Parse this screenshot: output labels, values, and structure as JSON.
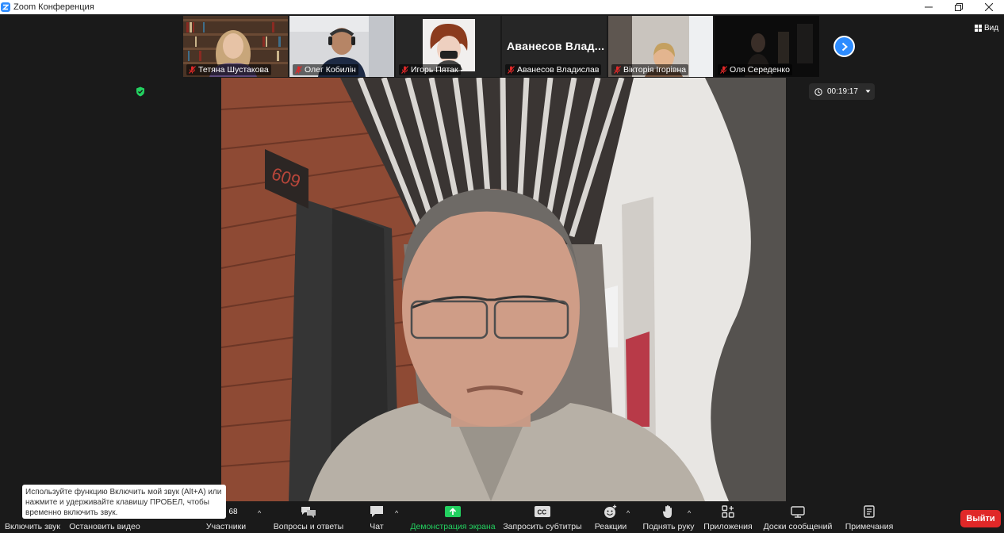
{
  "window": {
    "title": "Zoom Конференция"
  },
  "participants": [
    {
      "name": "Тетяна Шустакова"
    },
    {
      "name": "Олег Кобилін"
    },
    {
      "name": "Игорь Пятак"
    },
    {
      "name": "Аванесов Владислав",
      "display": "Аванесов  Влад..."
    },
    {
      "name": "Вікторія Ігорівна"
    },
    {
      "name": "Оля Середенко"
    }
  ],
  "view": {
    "label": "Вид"
  },
  "timer": {
    "value": "00:19:17"
  },
  "toolbar": {
    "unmute": "Включить звук",
    "stop_video": "Остановить видео",
    "participants": "Участники",
    "participants_count": "68",
    "qa": "Вопросы и ответы",
    "chat": "Чат",
    "share": "Демонстрация экрана",
    "captions": "Запросить субтитры",
    "reactions": "Реакции",
    "raise_hand": "Поднять руку",
    "apps": "Приложения",
    "whiteboards": "Доски сообщений",
    "notes": "Примечания",
    "leave": "Выйти"
  },
  "tooltip": {
    "text": "Используйте функцию Включить мой звук (Alt+A) или нажмите и удерживайте клавишу ПРОБЕЛ, чтобы временно включить звук."
  },
  "colors": {
    "accent": "#2d8cff",
    "share_green": "#23d160",
    "leave_red": "#e02828",
    "muted_red": "#e02828"
  },
  "scene": {
    "door_number": "609"
  }
}
